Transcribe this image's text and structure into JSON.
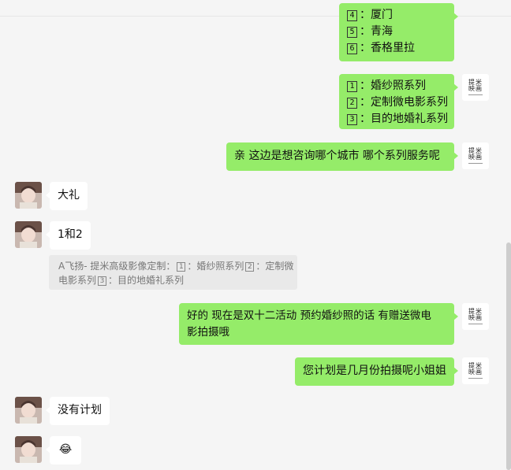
{
  "colors": {
    "me_bubble": "#95ec69",
    "them_bubble": "#ffffff",
    "background": "#f5f5f5"
  },
  "brand_avatar": {
    "line1": "提米",
    "line2": "映画"
  },
  "messages": {
    "m1": {
      "lines": [
        {
          "n": "4",
          "t": "厦门"
        },
        {
          "n": "5",
          "t": "青海"
        },
        {
          "n": "6",
          "t": "香格里拉"
        }
      ]
    },
    "m2": {
      "lines": [
        {
          "n": "1",
          "t": "婚纱照系列"
        },
        {
          "n": "2",
          "t": "定制微电影系列"
        },
        {
          "n": "3",
          "t": "目的地婚礼系列"
        }
      ]
    },
    "m3": {
      "text": "亲  这边是想咨询哪个城市  哪个系列服务呢"
    },
    "m4": {
      "text": "大礼"
    },
    "m5": {
      "text": "1和2"
    },
    "quote": {
      "prefix": "A飞扬- 提米高级影像定制：",
      "n1": "1",
      "t1": "：婚纱照系列",
      "n2": "2",
      "t2": "：定制微",
      "t2b": "电影系列",
      "n3": "3",
      "t3": "：目的地婚礼系列"
    },
    "m6": {
      "line1": "好的   现在是双十二活动   预约婚纱照的话  有赠送微电",
      "line2": "影拍摄哦"
    },
    "m7": {
      "text": "您计划是几月份拍摄呢小姐姐"
    },
    "m8": {
      "text": "没有计划"
    },
    "m9": {
      "emoji": "😂"
    }
  }
}
